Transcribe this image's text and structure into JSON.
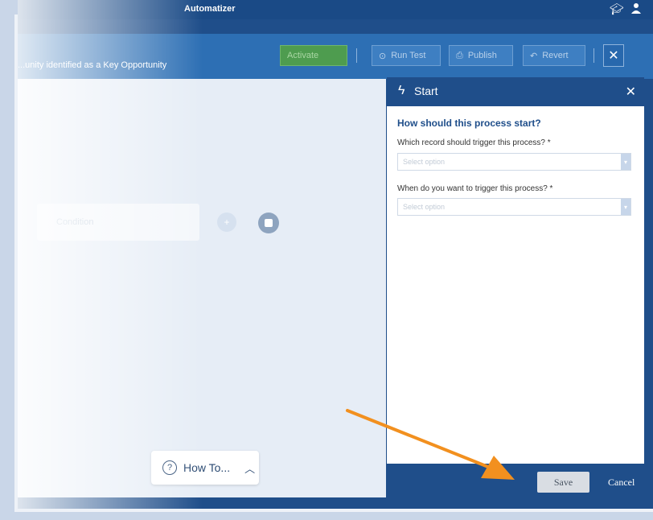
{
  "app": {
    "title": "Automatizer"
  },
  "process": {
    "name": "...unity identified as a Key Opportunity"
  },
  "toolbar": {
    "activate_label": "Activate",
    "run_test_label": "Run Test",
    "publish_label": "Publish",
    "revert_label": "Revert",
    "close_glyph": "✕"
  },
  "canvas": {
    "node_label": "Condition",
    "plus_glyph": "+",
    "howto_label": "How To..."
  },
  "panel": {
    "title": "Start",
    "close_glyph": "✕",
    "question": "How should this process start?",
    "field1_label": "Which record should trigger this process? *",
    "field1_placeholder": "Select option",
    "field2_label": "When do you want to trigger this process? *",
    "field2_placeholder": "Select option"
  },
  "footer": {
    "save_label": "Save",
    "cancel_label": "Cancel"
  },
  "colors": {
    "primary": "#1f4e8a",
    "toolbar": "#2d6fb4",
    "accent_arrow": "#f2901f",
    "activate": "#4e9c4f"
  }
}
